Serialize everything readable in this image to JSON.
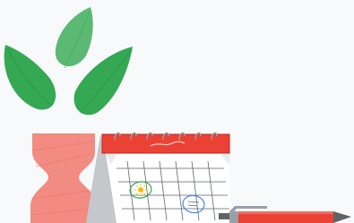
{
  "illustration": {
    "subject": "plant-calendar-pen",
    "colors": {
      "background": "#f8f9fb",
      "leaf_dark": "#34a853",
      "leaf_light": "#5bb974",
      "leaf_vein": "#2a8c46",
      "vase": "#f28b82",
      "vase_stroke": "#e57368",
      "calendar_header": "#ea4335",
      "calendar_header_stroke": "#c5221f",
      "calendar_page": "#ffffff",
      "calendar_grid": "#5f6368",
      "calendar_side": "#c4c7cc",
      "ring": "#9aa0a6",
      "mark_green": "#34a853",
      "mark_yellow": "#fbbc04",
      "mark_blue": "#4285f4",
      "pen_body": "#ea4335",
      "pen_cap": "#9aa0a6",
      "pen_tip": "#5f6368"
    },
    "icons": [
      "plant-icon",
      "vase-icon",
      "calendar-icon",
      "pen-icon",
      "sun-doodle-icon",
      "note-doodle-icon"
    ]
  }
}
